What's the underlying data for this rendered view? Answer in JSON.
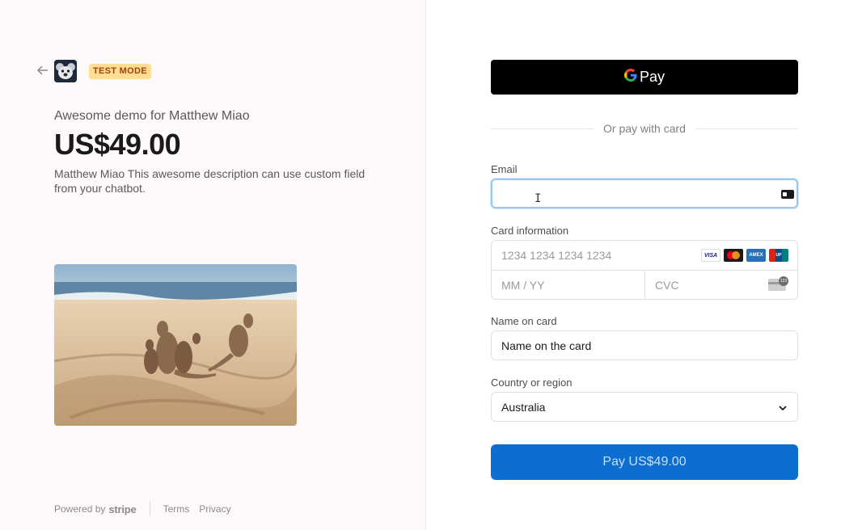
{
  "header": {
    "badge": "TEST MODE",
    "back_icon": "arrow-left-icon",
    "logo_icon": "koala-logo"
  },
  "product": {
    "name": "Awesome demo for Matthew Miao",
    "price": "US$49.00",
    "description": "Matthew Miao This awesome description can use custom field from your chatbot.",
    "image": "kangaroos-on-beach-photo"
  },
  "footer": {
    "powered_by": "Powered by",
    "stripe": "stripe",
    "terms": "Terms",
    "privacy": "Privacy"
  },
  "payment": {
    "gpay_g": "G",
    "gpay_label": "Pay",
    "divider_text": "Or pay with card",
    "email_label": "Email",
    "email_value": "",
    "card_label": "Card information",
    "card_number_placeholder": "1234 1234 1234 1234",
    "expiry_placeholder": "MM / YY",
    "cvc_placeholder": "CVC",
    "brands": [
      "VISA",
      "Mastercard",
      "AMEX",
      "UnionPay"
    ],
    "name_label": "Name on card",
    "name_value": "Name on the card",
    "country_label": "Country or region",
    "country_value": "Australia",
    "pay_button": "Pay US$49.00"
  },
  "colors": {
    "pay_button": "#0d6ed1",
    "badge_bg": "#ffde92",
    "badge_text": "#a2410a",
    "focus_ring": "#9ac8f0"
  }
}
